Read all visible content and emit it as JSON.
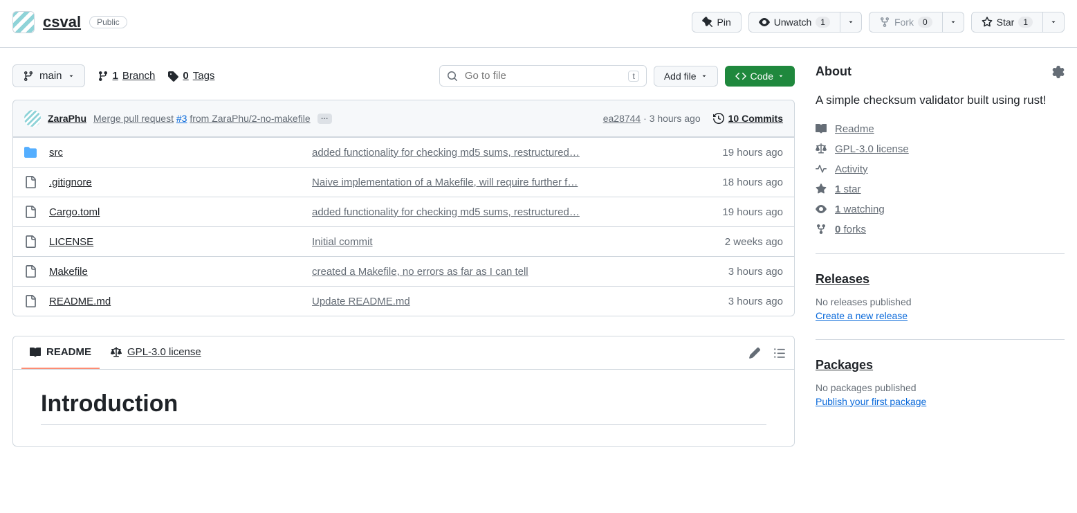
{
  "repo": {
    "name": "csval",
    "visibility": "Public"
  },
  "actions": {
    "pin": "Pin",
    "unwatch": "Unwatch",
    "unwatch_count": "1",
    "fork": "Fork",
    "fork_count": "0",
    "star": "Star",
    "star_count": "1"
  },
  "toolbar": {
    "branch": "main",
    "branches_count": "1",
    "branches_label": "Branch",
    "tags_count": "0",
    "tags_label": "Tags",
    "search_placeholder": "Go to file",
    "search_kbd": "t",
    "add_file": "Add file",
    "code": "Code"
  },
  "latest_commit": {
    "author": "ZaraPhu",
    "message_prefix": "Merge pull request",
    "pr": "#3",
    "message_suffix": "from ZaraPhu/2-no-makefile",
    "sha": "ea28744",
    "time": "3 hours ago",
    "commits_count": "10 Commits"
  },
  "files": [
    {
      "name": "src",
      "type": "dir",
      "message": "added functionality for checking md5 sums, restructured…",
      "time": "19 hours ago"
    },
    {
      "name": ".gitignore",
      "type": "file",
      "message": "Naive implementation of a Makefile, will require further f…",
      "time": "18 hours ago"
    },
    {
      "name": "Cargo.toml",
      "type": "file",
      "message": "added functionality for checking md5 sums, restructured…",
      "time": "19 hours ago"
    },
    {
      "name": "LICENSE",
      "type": "file",
      "message": "Initial commit",
      "time": "2 weeks ago"
    },
    {
      "name": "Makefile",
      "type": "file",
      "message": "created a Makefile, no errors as far as I can tell",
      "time": "3 hours ago"
    },
    {
      "name": "README.md",
      "type": "file",
      "message": "Update README.md",
      "time": "3 hours ago"
    }
  ],
  "readme_tabs": {
    "readme": "README",
    "license": "GPL-3.0 license"
  },
  "readme": {
    "heading": "Introduction"
  },
  "about": {
    "title": "About",
    "description": "A simple checksum validator built using rust!",
    "readme": "Readme",
    "license": "GPL-3.0 license",
    "activity": "Activity",
    "stars_count": "1",
    "stars_label": "star",
    "watching_count": "1",
    "watching_label": "watching",
    "forks_count": "0",
    "forks_label": "forks"
  },
  "releases": {
    "title": "Releases",
    "empty": "No releases published",
    "link": "Create a new release"
  },
  "packages": {
    "title": "Packages",
    "empty": "No packages published",
    "link": "Publish your first package"
  }
}
